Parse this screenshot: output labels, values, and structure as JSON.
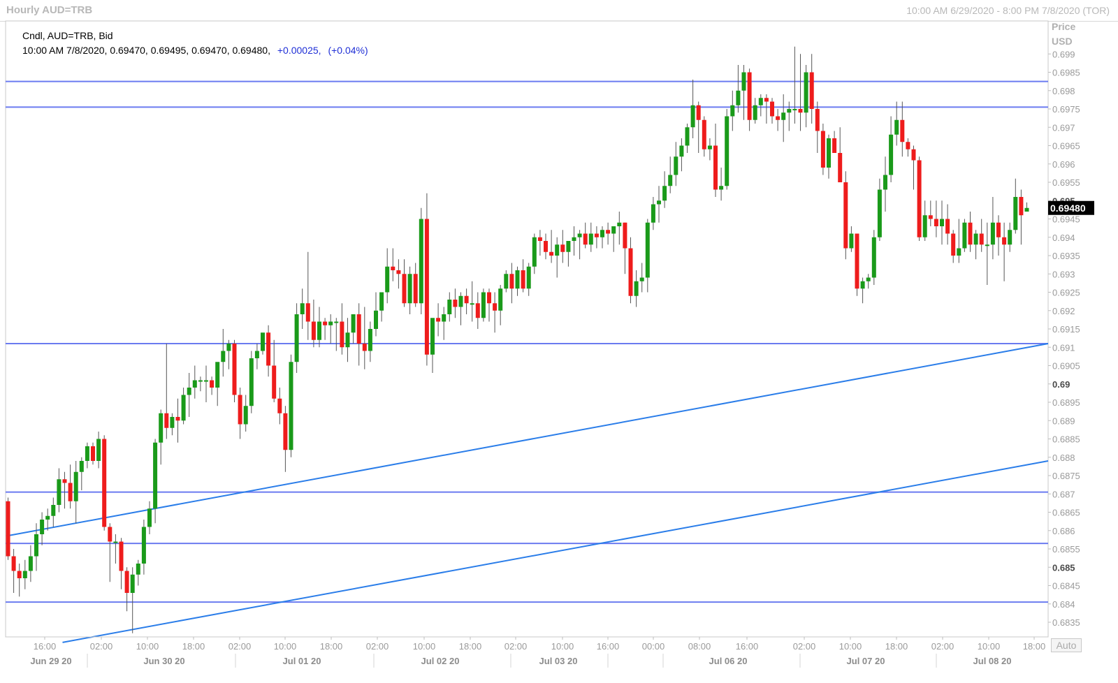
{
  "window": {
    "title": "Hourly AUD=TRB",
    "range": "10:00 AM 6/29/2020 - 8:00 PM 7/8/2020 (TOR)"
  },
  "legend": {
    "line1": "Cndl, AUD=TRB, Bid",
    "ohlc": "10:00 AM 7/8/2020, 0.69470, 0.69495, 0.69470, 0.69480,",
    "change": "+0.00025,",
    "change_pct": "(+0.04%)"
  },
  "price_axis": {
    "title": "Price",
    "unit": "USD",
    "last_price": "0.69480",
    "auto_button": "Auto"
  },
  "colors": {
    "up": "#1a9a1a",
    "down": "#ee1c1c",
    "hline": "#6b7bf0",
    "trendline": "#2a7de9",
    "change": "#1f2fd6",
    "last_price_bg": "#000000"
  },
  "chart_data": {
    "type": "candlestick",
    "symbol": "AUD=TRB",
    "interval": "Hourly",
    "ylim": [
      0.6831,
      0.6999
    ],
    "y_ticks": [
      "0.699",
      "0.6985",
      "0.698",
      "0.6975",
      "0.697",
      "0.6965",
      "0.696",
      "0.6955",
      "0.695",
      "0.6945",
      "0.694",
      "0.6935",
      "0.693",
      "0.6925",
      "0.692",
      "0.6915",
      "0.691",
      "0.6905",
      "0.69",
      "0.6895",
      "0.689",
      "0.6885",
      "0.688",
      "0.6875",
      "0.687",
      "0.6865",
      "0.686",
      "0.6855",
      "0.685",
      "0.6845",
      "0.684",
      "0.6835"
    ],
    "x_time_labels": [
      "16:00",
      "02:00",
      "10:00",
      "18:00",
      "02:00",
      "10:00",
      "18:00",
      "02:00",
      "10:00",
      "18:00",
      "02:00",
      "10:00",
      "16:00",
      "00:00",
      "08:00",
      "16:00",
      "02:00",
      "10:00",
      "18:00",
      "02:00",
      "10:00",
      "18:00"
    ],
    "x_date_labels": [
      "Jun 29 20",
      "Jun 30 20",
      "Jul 01 20",
      "Jul 02 20",
      "Jul 03 20",
      "Jul 06 20",
      "Jul 07 20",
      "Jul 08 20"
    ],
    "horizontal_lines": [
      0.69825,
      0.69755,
      0.6911,
      0.68705,
      0.68565,
      0.68405
    ],
    "trendlines": [
      {
        "from": {
          "bar": 0,
          "price": 0.68585
        },
        "to": {
          "bar": 178,
          "price": 0.6911
        }
      },
      {
        "from": {
          "bar": 10,
          "price": 0.68295
        },
        "to": {
          "bar": 178,
          "price": 0.6879
        }
      }
    ],
    "candles": [
      [
        0.6868,
        0.6869,
        0.6852,
        0.6853
      ],
      [
        0.6853,
        0.6855,
        0.6843,
        0.6849
      ],
      [
        0.6849,
        0.6851,
        0.6842,
        0.6847
      ],
      [
        0.6847,
        0.6852,
        0.6844,
        0.6849
      ],
      [
        0.6849,
        0.6856,
        0.6846,
        0.6853
      ],
      [
        0.6853,
        0.6862,
        0.6849,
        0.6859
      ],
      [
        0.6859,
        0.6865,
        0.6856,
        0.6863
      ],
      [
        0.6863,
        0.6866,
        0.686,
        0.6864
      ],
      [
        0.6864,
        0.6869,
        0.6861,
        0.6867
      ],
      [
        0.6867,
        0.6877,
        0.6865,
        0.6874
      ],
      [
        0.6874,
        0.6876,
        0.6866,
        0.6873
      ],
      [
        0.6873,
        0.6878,
        0.6866,
        0.6868
      ],
      [
        0.6868,
        0.6879,
        0.6862,
        0.6876
      ],
      [
        0.6876,
        0.688,
        0.6871,
        0.6879
      ],
      [
        0.6879,
        0.6884,
        0.6877,
        0.6883
      ],
      [
        0.6883,
        0.6884,
        0.6878,
        0.6879
      ],
      [
        0.6879,
        0.6887,
        0.6877,
        0.6885
      ],
      [
        0.6885,
        0.6886,
        0.686,
        0.6861
      ],
      [
        0.6861,
        0.6862,
        0.6846,
        0.6857
      ],
      [
        0.6857,
        0.6859,
        0.6851,
        0.6857
      ],
      [
        0.6857,
        0.6858,
        0.6844,
        0.6849
      ],
      [
        0.6849,
        0.685,
        0.6838,
        0.6843
      ],
      [
        0.6843,
        0.685,
        0.6832,
        0.6848
      ],
      [
        0.6848,
        0.6852,
        0.6845,
        0.6851
      ],
      [
        0.6851,
        0.6863,
        0.6848,
        0.6861
      ],
      [
        0.6861,
        0.6868,
        0.6859,
        0.6866
      ],
      [
        0.6866,
        0.6885,
        0.6862,
        0.6884
      ],
      [
        0.6884,
        0.6893,
        0.6878,
        0.6892
      ],
      [
        0.6892,
        0.6911,
        0.6885,
        0.6888
      ],
      [
        0.6888,
        0.6892,
        0.6886,
        0.6891
      ],
      [
        0.6891,
        0.6896,
        0.6884,
        0.689
      ],
      [
        0.689,
        0.6899,
        0.6889,
        0.6897
      ],
      [
        0.6897,
        0.6903,
        0.6891,
        0.6899
      ],
      [
        0.6899,
        0.6905,
        0.6896,
        0.6901
      ],
      [
        0.6901,
        0.6902,
        0.6898,
        0.6901
      ],
      [
        0.6901,
        0.6905,
        0.6895,
        0.6901
      ],
      [
        0.6901,
        0.6902,
        0.6897,
        0.6899
      ],
      [
        0.6899,
        0.6903,
        0.6894,
        0.6906
      ],
      [
        0.6906,
        0.6915,
        0.6902,
        0.6909
      ],
      [
        0.6909,
        0.6912,
        0.6904,
        0.6911
      ],
      [
        0.6911,
        0.6912,
        0.6895,
        0.6897
      ],
      [
        0.6897,
        0.6899,
        0.6885,
        0.6889
      ],
      [
        0.6889,
        0.6897,
        0.6887,
        0.6894
      ],
      [
        0.6894,
        0.6909,
        0.6892,
        0.6907
      ],
      [
        0.6907,
        0.6911,
        0.6904,
        0.6909
      ],
      [
        0.6909,
        0.6913,
        0.6908,
        0.6914
      ],
      [
        0.6914,
        0.6916,
        0.6902,
        0.6905
      ],
      [
        0.6905,
        0.6912,
        0.6895,
        0.6896
      ],
      [
        0.6896,
        0.6899,
        0.6889,
        0.6892
      ],
      [
        0.6892,
        0.6894,
        0.6876,
        0.6882
      ],
      [
        0.6882,
        0.6908,
        0.688,
        0.6906
      ],
      [
        0.6906,
        0.6922,
        0.6903,
        0.6919
      ],
      [
        0.6919,
        0.6926,
        0.6915,
        0.6922
      ],
      [
        0.6922,
        0.6936,
        0.6912,
        0.6917
      ],
      [
        0.6917,
        0.6923,
        0.691,
        0.6912
      ],
      [
        0.6912,
        0.6921,
        0.691,
        0.6917
      ],
      [
        0.6917,
        0.6918,
        0.6912,
        0.6916
      ],
      [
        0.6916,
        0.6919,
        0.6911,
        0.6917
      ],
      [
        0.6917,
        0.6918,
        0.6909,
        0.6917
      ],
      [
        0.6917,
        0.6922,
        0.6908,
        0.691
      ],
      [
        0.691,
        0.6918,
        0.6906,
        0.6914
      ],
      [
        0.6914,
        0.6918,
        0.6911,
        0.6919
      ],
      [
        0.6919,
        0.6922,
        0.6905,
        0.6911
      ],
      [
        0.6911,
        0.6921,
        0.6904,
        0.6909
      ],
      [
        0.6909,
        0.6917,
        0.6906,
        0.6915
      ],
      [
        0.6915,
        0.6925,
        0.6913,
        0.692
      ],
      [
        0.692,
        0.6925,
        0.6917,
        0.6925
      ],
      [
        0.6925,
        0.6937,
        0.6922,
        0.6932
      ],
      [
        0.6932,
        0.6937,
        0.6928,
        0.6931
      ],
      [
        0.6931,
        0.6934,
        0.6926,
        0.693
      ],
      [
        0.693,
        0.6934,
        0.6921,
        0.6922
      ],
      [
        0.6922,
        0.6932,
        0.6919,
        0.693
      ],
      [
        0.693,
        0.6933,
        0.6921,
        0.6922
      ],
      [
        0.6922,
        0.6948,
        0.6919,
        0.6945
      ],
      [
        0.6945,
        0.6952,
        0.6905,
        0.6908
      ],
      [
        0.6908,
        0.6916,
        0.6903,
        0.6918
      ],
      [
        0.6918,
        0.6922,
        0.6913,
        0.6917
      ],
      [
        0.6917,
        0.6921,
        0.6912,
        0.6919
      ],
      [
        0.6919,
        0.6925,
        0.6917,
        0.6923
      ],
      [
        0.6923,
        0.6926,
        0.6918,
        0.6921
      ],
      [
        0.6921,
        0.6925,
        0.6916,
        0.6924
      ],
      [
        0.6924,
        0.6926,
        0.6919,
        0.6922
      ],
      [
        0.6922,
        0.6928,
        0.6917,
        0.6922
      ],
      [
        0.6922,
        0.6925,
        0.6915,
        0.6918
      ],
      [
        0.6918,
        0.6926,
        0.6917,
        0.6925
      ],
      [
        0.6925,
        0.6926,
        0.6917,
        0.6922
      ],
      [
        0.6922,
        0.6925,
        0.6914,
        0.692
      ],
      [
        0.692,
        0.6927,
        0.6916,
        0.6926
      ],
      [
        0.6926,
        0.6931,
        0.6925,
        0.693
      ],
      [
        0.693,
        0.6933,
        0.6922,
        0.6926
      ],
      [
        0.6926,
        0.6932,
        0.6924,
        0.6931
      ],
      [
        0.6931,
        0.6934,
        0.6925,
        0.6926
      ],
      [
        0.6926,
        0.6933,
        0.6924,
        0.6932
      ],
      [
        0.6932,
        0.6941,
        0.693,
        0.694
      ],
      [
        0.694,
        0.6942,
        0.6935,
        0.6939
      ],
      [
        0.6939,
        0.6941,
        0.6934,
        0.6936
      ],
      [
        0.6936,
        0.6942,
        0.6933,
        0.6935
      ],
      [
        0.6935,
        0.694,
        0.6929,
        0.6938
      ],
      [
        0.6938,
        0.6942,
        0.6933,
        0.6936
      ],
      [
        0.6936,
        0.6938,
        0.6932,
        0.6939
      ],
      [
        0.6939,
        0.6943,
        0.6935,
        0.694
      ],
      [
        0.694,
        0.6942,
        0.6934,
        0.6941
      ],
      [
        0.6941,
        0.6944,
        0.6937,
        0.6938
      ],
      [
        0.6938,
        0.6944,
        0.6936,
        0.6941
      ],
      [
        0.6941,
        0.6943,
        0.6937,
        0.694
      ],
      [
        0.694,
        0.6943,
        0.6937,
        0.6942
      ],
      [
        0.6942,
        0.6944,
        0.6938,
        0.6941
      ],
      [
        0.6941,
        0.6943,
        0.6936,
        0.6943
      ],
      [
        0.6943,
        0.6947,
        0.6938,
        0.6944
      ],
      [
        0.6944,
        0.6944,
        0.693,
        0.6937
      ],
      [
        0.6937,
        0.694,
        0.6922,
        0.6924
      ],
      [
        0.6924,
        0.6931,
        0.6921,
        0.6928
      ],
      [
        0.6928,
        0.6933,
        0.6925,
        0.6929
      ],
      [
        0.6929,
        0.6945,
        0.6925,
        0.6944
      ],
      [
        0.6944,
        0.6951,
        0.6942,
        0.6949
      ],
      [
        0.6949,
        0.6954,
        0.6944,
        0.695
      ],
      [
        0.695,
        0.6958,
        0.6948,
        0.6954
      ],
      [
        0.6954,
        0.6962,
        0.6952,
        0.6957
      ],
      [
        0.6957,
        0.6966,
        0.6954,
        0.6962
      ],
      [
        0.6962,
        0.6967,
        0.6958,
        0.6965
      ],
      [
        0.6965,
        0.6971,
        0.6963,
        0.697
      ],
      [
        0.697,
        0.6983,
        0.6967,
        0.6976
      ],
      [
        0.6976,
        0.6977,
        0.6963,
        0.6972
      ],
      [
        0.6972,
        0.6973,
        0.6962,
        0.6964
      ],
      [
        0.6964,
        0.6967,
        0.6961,
        0.6965
      ],
      [
        0.6965,
        0.6971,
        0.6951,
        0.6953
      ],
      [
        0.6953,
        0.6959,
        0.695,
        0.6954
      ],
      [
        0.6954,
        0.6975,
        0.6953,
        0.6973
      ],
      [
        0.6973,
        0.698,
        0.6969,
        0.6976
      ],
      [
        0.6976,
        0.6987,
        0.6974,
        0.698
      ],
      [
        0.698,
        0.6987,
        0.6972,
        0.6985
      ],
      [
        0.6985,
        0.6986,
        0.6969,
        0.6972
      ],
      [
        0.6972,
        0.6978,
        0.6971,
        0.6976
      ],
      [
        0.6976,
        0.6979,
        0.6973,
        0.6978
      ],
      [
        0.6978,
        0.6979,
        0.6971,
        0.6977
      ],
      [
        0.6977,
        0.6978,
        0.6971,
        0.6973
      ],
      [
        0.6973,
        0.6975,
        0.6969,
        0.6972
      ],
      [
        0.6972,
        0.6979,
        0.6966,
        0.6974
      ],
      [
        0.6974,
        0.6977,
        0.6969,
        0.6975
      ],
      [
        0.6975,
        0.6992,
        0.6971,
        0.6975
      ],
      [
        0.6975,
        0.699,
        0.6969,
        0.6974
      ],
      [
        0.6974,
        0.6987,
        0.697,
        0.6985
      ],
      [
        0.6985,
        0.699,
        0.6971,
        0.6975
      ],
      [
        0.6975,
        0.6977,
        0.6963,
        0.6969
      ],
      [
        0.6969,
        0.6971,
        0.6957,
        0.6959
      ],
      [
        0.6959,
        0.6968,
        0.6956,
        0.6967
      ],
      [
        0.6967,
        0.6969,
        0.6964,
        0.6963
      ],
      [
        0.6963,
        0.697,
        0.6955,
        0.6955
      ],
      [
        0.6955,
        0.6958,
        0.6934,
        0.6937
      ],
      [
        0.6937,
        0.6943,
        0.6936,
        0.6941
      ],
      [
        0.6941,
        0.6941,
        0.6924,
        0.6926
      ],
      [
        0.6926,
        0.6929,
        0.6922,
        0.6928
      ],
      [
        0.6928,
        0.693,
        0.6926,
        0.6929
      ],
      [
        0.6929,
        0.6942,
        0.6927,
        0.694
      ],
      [
        0.694,
        0.6956,
        0.6939,
        0.6953
      ],
      [
        0.6953,
        0.6962,
        0.6947,
        0.6957
      ],
      [
        0.6957,
        0.6973,
        0.6955,
        0.6968
      ],
      [
        0.6968,
        0.6977,
        0.6965,
        0.6972
      ],
      [
        0.6972,
        0.6977,
        0.6962,
        0.6966
      ],
      [
        0.6966,
        0.6967,
        0.6962,
        0.6964
      ],
      [
        0.6964,
        0.6965,
        0.6953,
        0.6961
      ],
      [
        0.6961,
        0.6962,
        0.6939,
        0.694
      ],
      [
        0.694,
        0.695,
        0.6939,
        0.6946
      ],
      [
        0.6946,
        0.695,
        0.6943,
        0.6945
      ],
      [
        0.6945,
        0.695,
        0.694,
        0.6943
      ],
      [
        0.6943,
        0.695,
        0.6938,
        0.6945
      ],
      [
        0.6945,
        0.6949,
        0.6938,
        0.6941
      ],
      [
        0.6941,
        0.6942,
        0.6933,
        0.6935
      ],
      [
        0.6935,
        0.6945,
        0.6933,
        0.6937
      ],
      [
        0.6937,
        0.6945,
        0.6936,
        0.6944
      ],
      [
        0.6944,
        0.6947,
        0.6936,
        0.6938
      ],
      [
        0.6938,
        0.6942,
        0.6934,
        0.6941
      ],
      [
        0.6941,
        0.6945,
        0.6936,
        0.6938
      ],
      [
        0.6938,
        0.6944,
        0.6927,
        0.6938
      ],
      [
        0.6938,
        0.6951,
        0.6934,
        0.6944
      ],
      [
        0.6944,
        0.6946,
        0.6935,
        0.694
      ],
      [
        0.694,
        0.6944,
        0.6928,
        0.6938
      ],
      [
        0.6938,
        0.6944,
        0.6936,
        0.6942
      ],
      [
        0.6942,
        0.6956,
        0.6941,
        0.6951
      ],
      [
        0.6951,
        0.6953,
        0.6938,
        0.6946
      ],
      [
        0.6947,
        0.69495,
        0.6947,
        0.6948
      ]
    ]
  }
}
